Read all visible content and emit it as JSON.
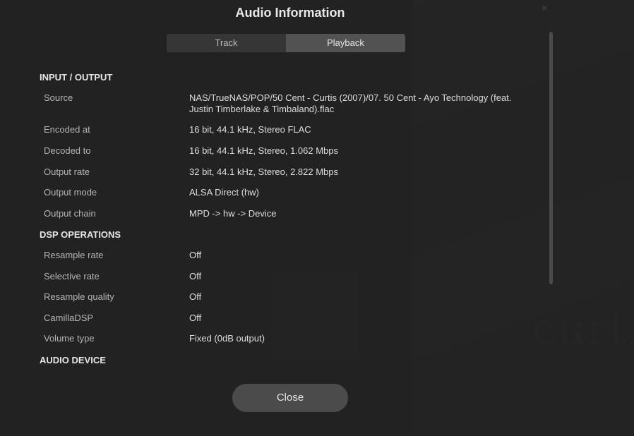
{
  "dialog": {
    "title": "Audio Information",
    "close_icon": "×"
  },
  "tabs": [
    {
      "label": "Track",
      "active": false
    },
    {
      "label": "Playback",
      "active": true
    }
  ],
  "sections": {
    "io": {
      "heading": "INPUT / OUTPUT",
      "rows": [
        {
          "label": "Source",
          "value": "NAS/TrueNAS/POP/50 Cent - Curtis (2007)/07. 50 Cent - Ayo Technology (feat. Justin Timberlake & Timbaland).flac"
        },
        {
          "label": "Encoded at",
          "value": "16 bit, 44.1 kHz, Stereo FLAC"
        },
        {
          "label": "Decoded to",
          "value": "16 bit, 44.1 kHz, Stereo, 1.062 Mbps"
        },
        {
          "label": "Output rate",
          "value": "32 bit, 44.1 kHz, Stereo, 2.822 Mbps"
        },
        {
          "label": "Output mode",
          "value": "ALSA Direct (hw)"
        },
        {
          "label": "Output chain",
          "value": "MPD -> hw -> Device"
        }
      ]
    },
    "dsp": {
      "heading": "DSP OPERATIONS",
      "rows": [
        {
          "label": "Resample rate",
          "value": "Off"
        },
        {
          "label": "Selective rate",
          "value": "Off"
        },
        {
          "label": "Resample quality",
          "value": "Off"
        },
        {
          "label": "CamillaDSP",
          "value": "Off"
        },
        {
          "label": "Volume type",
          "value": "Fixed (0dB output)"
        }
      ]
    },
    "device": {
      "heading": "AUDIO DEVICE"
    }
  },
  "footer": {
    "close_label": "Close"
  },
  "background": {
    "album_text": "curtis"
  },
  "colors": {
    "overlay": "#222222",
    "tab_active": "#525252",
    "tab_inactive": "#363636",
    "button": "#4b4b4b"
  }
}
